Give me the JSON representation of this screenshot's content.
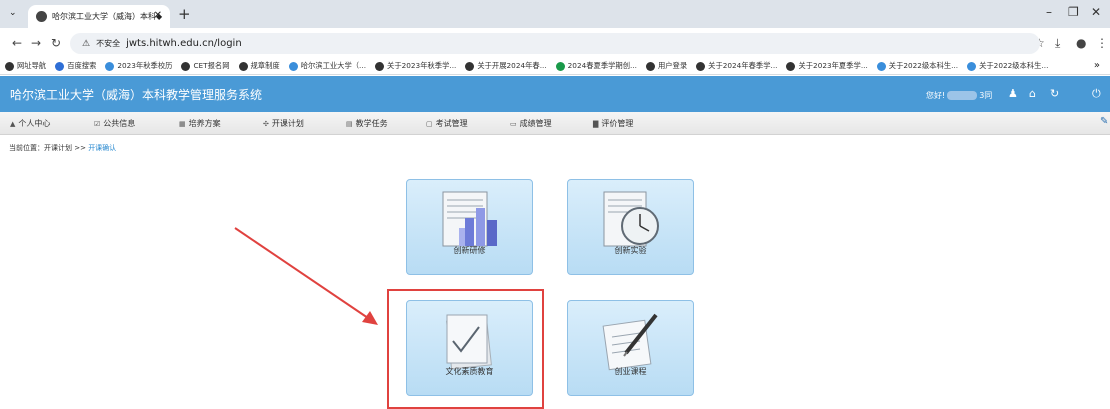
{
  "browser": {
    "tab_title": "哈尔滨工业大学（威海）本科◆",
    "url": "jwts.hitwh.edu.cn/login",
    "insecure_label": "不安全",
    "bookmarks": [
      {
        "label": "网址导航",
        "color": "#333333"
      },
      {
        "label": "百度搜索",
        "color": "#2f6fd6"
      },
      {
        "label": "2023年秋季校历",
        "color": "#3a8edb"
      },
      {
        "label": "CET报名网",
        "color": "#333333"
      },
      {
        "label": "规章制度",
        "color": "#333333"
      },
      {
        "label": "哈尔滨工业大学（...",
        "color": "#3a8edb"
      },
      {
        "label": "关于2023年秋季学...",
        "color": "#333333"
      },
      {
        "label": "关于开展2024年春...",
        "color": "#333333"
      },
      {
        "label": "2024春夏季学期创...",
        "color": "#1a9a4a"
      },
      {
        "label": "用户登录",
        "color": "#333333"
      },
      {
        "label": "关于2024年春季学...",
        "color": "#333333"
      },
      {
        "label": "关于2023年夏季学...",
        "color": "#333333"
      },
      {
        "label": "关于2022级本科生...",
        "color": "#3a8edb"
      },
      {
        "label": "关于2022级本科生...",
        "color": "#3a8edb"
      }
    ]
  },
  "site": {
    "title": "哈尔滨工业大学（威海）本科教学管理服务系统",
    "greeting_prefix": "您好!",
    "greeting_suffix": "3同"
  },
  "menu": [
    {
      "label": "个人中心",
      "icon": "▲"
    },
    {
      "label": "公共信息",
      "icon": "☑"
    },
    {
      "label": "培养方案",
      "icon": "▦"
    },
    {
      "label": "开课计划",
      "icon": "✣"
    },
    {
      "label": "教学任务",
      "icon": "▤"
    },
    {
      "label": "考试管理",
      "icon": "▢"
    },
    {
      "label": "成绩管理",
      "icon": "▭"
    },
    {
      "label": "评价管理",
      "icon": "▇"
    }
  ],
  "breadcrumb": {
    "prefix": "当前位置：开课计划 >> ",
    "current": "开课确认"
  },
  "tiles": [
    {
      "label": "创新研修",
      "icon": "bar-chart-icon"
    },
    {
      "label": "创新实验",
      "icon": "clock-icon"
    },
    {
      "label": "文化素质教育",
      "icon": "checkmark-icon"
    },
    {
      "label": "创业课程",
      "icon": "pen-document-icon"
    }
  ],
  "colors": {
    "header": "#4a9ad6",
    "highlight": "#e0423f"
  }
}
